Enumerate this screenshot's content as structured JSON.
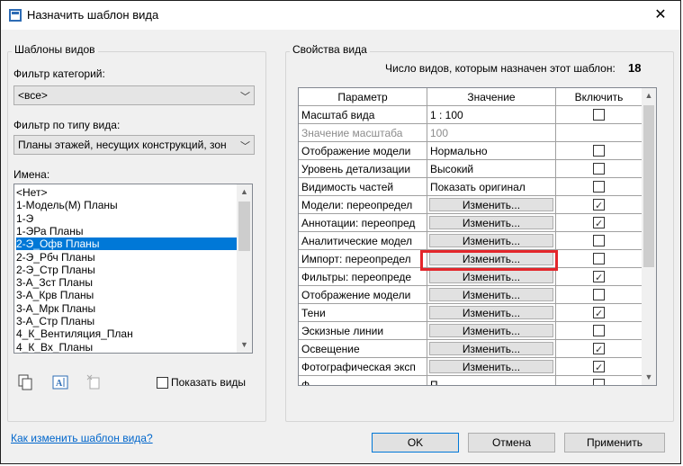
{
  "window": {
    "title": "Назначить шаблон вида",
    "close_glyph": "✕"
  },
  "left": {
    "group_label": "Шаблоны видов",
    "category_filter_label": "Фильтр категорий:",
    "category_filter_value": "<все>",
    "type_filter_label": "Фильтр по типу вида:",
    "type_filter_value": "Планы этажей, несущих конструкций, зон",
    "names_label": "Имена:",
    "names": [
      "<Нет>",
      "1-Модель(М) Планы",
      "1-Э",
      "1-ЭРа Планы",
      "2-Э_Офв Планы",
      "2-Э_Рбч Планы",
      "2-Э_Стр Планы",
      "3-А_Зст Планы",
      "3-А_Крв Планы",
      "3-А_Мрк Планы",
      "3-А_Стр Планы",
      "4_К_Вентиляция_План",
      "4_К_Вх_Планы"
    ],
    "selected_index": 4,
    "show_views_label": "Показать виды",
    "tool_icons": [
      "duplicate-icon",
      "rename-icon",
      "delete-icon"
    ]
  },
  "right": {
    "group_label": "Свойства вида",
    "count_label": "Число видов, которым назначен этот шаблон:",
    "count_value": "18",
    "columns": [
      "Параметр",
      "Значение",
      "Включить"
    ],
    "rows": [
      {
        "param": "Масштаб вида",
        "value": "1 : 100",
        "button": false,
        "include": false,
        "grey": false,
        "has_check": true
      },
      {
        "param": "Значение масштаба",
        "value": "100",
        "button": false,
        "include": false,
        "grey": true,
        "has_check": false
      },
      {
        "param": "Отображение модели",
        "value": "Нормально",
        "button": false,
        "include": false,
        "grey": false,
        "has_check": true
      },
      {
        "param": "Уровень детализации",
        "value": "Высокий",
        "button": false,
        "include": false,
        "grey": false,
        "has_check": true
      },
      {
        "param": "Видимость частей",
        "value": "Показать оригинал",
        "button": false,
        "include": false,
        "grey": false,
        "has_check": true
      },
      {
        "param": "Модели: переопредел",
        "value": "Изменить...",
        "button": true,
        "include": true,
        "grey": false,
        "has_check": true
      },
      {
        "param": "Аннотации: переопред",
        "value": "Изменить...",
        "button": true,
        "include": true,
        "grey": false,
        "has_check": true
      },
      {
        "param": "Аналитические модел",
        "value": "Изменить...",
        "button": true,
        "include": false,
        "grey": false,
        "has_check": true
      },
      {
        "param": "Импорт: переопредел",
        "value": "Изменить...",
        "button": true,
        "include": false,
        "grey": false,
        "has_check": true
      },
      {
        "param": "Фильтры: переопреде",
        "value": "Изменить...",
        "button": true,
        "include": true,
        "grey": false,
        "has_check": true
      },
      {
        "param": "Отображение модели",
        "value": "Изменить...",
        "button": true,
        "include": false,
        "grey": false,
        "has_check": true
      },
      {
        "param": "Тени",
        "value": "Изменить...",
        "button": true,
        "include": true,
        "grey": false,
        "has_check": true
      },
      {
        "param": "Эскизные линии",
        "value": "Изменить...",
        "button": true,
        "include": false,
        "grey": false,
        "has_check": true
      },
      {
        "param": "Освещение",
        "value": "Изменить...",
        "button": true,
        "include": true,
        "grey": false,
        "has_check": true
      },
      {
        "param": "Фотографическая эксп",
        "value": "Изменить...",
        "button": true,
        "include": true,
        "grey": false,
        "has_check": true
      },
      {
        "param": "Ф",
        "value": "П",
        "button": false,
        "include": false,
        "grey": false,
        "has_check": true
      }
    ],
    "highlighted_row": 8
  },
  "footer": {
    "help_link": "Как изменить шаблон вида?",
    "ok": "OK",
    "cancel": "Отмена",
    "apply": "Применить"
  },
  "colors": {
    "selection": "#0078d7",
    "highlight_border": "#e3262b",
    "link": "#0066cc"
  }
}
